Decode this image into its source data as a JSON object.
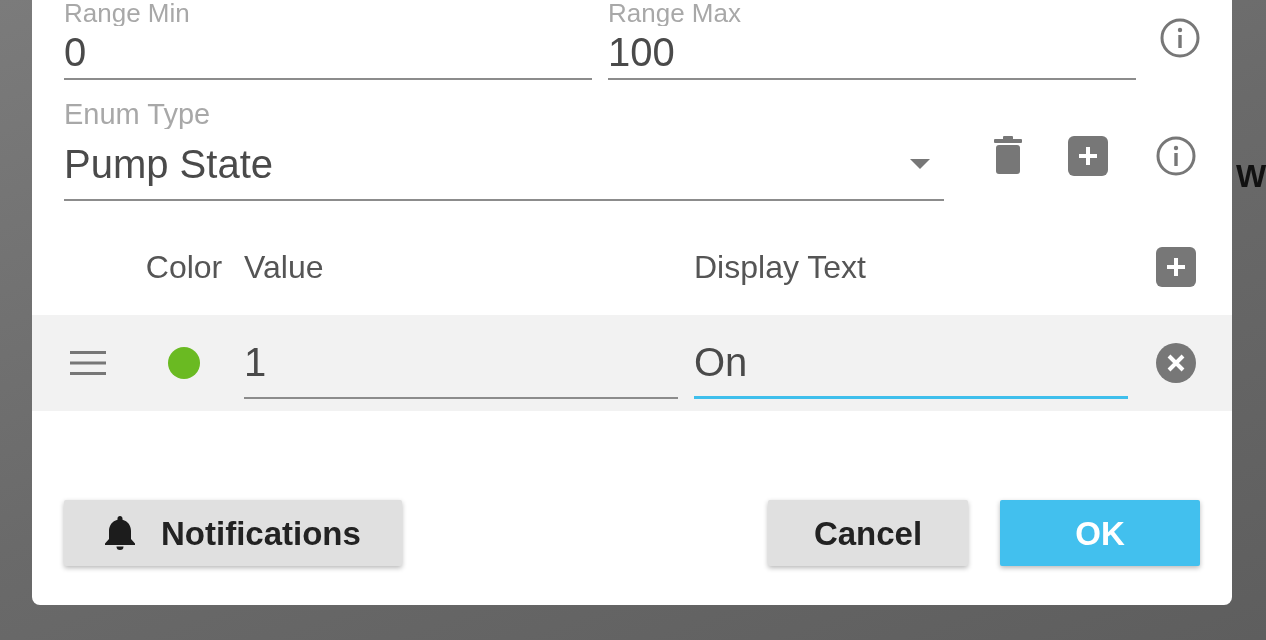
{
  "background_text": "W",
  "dialog": {
    "range": [
      {
        "label": "Range Min",
        "value": "0"
      },
      {
        "label": "Range Max",
        "value": "100"
      }
    ],
    "enum_type": {
      "label": "Enum Type",
      "value": "Pump State"
    },
    "enum_table": {
      "columns": [
        "Color",
        "Value",
        "Display Text"
      ],
      "rows": [
        {
          "color": "#6aba22",
          "value": {
            "text": "1",
            "focused": false
          },
          "display_text": {
            "text": "On",
            "focused": true
          }
        }
      ]
    },
    "footer": {
      "left": [
        {
          "label": "Notifications",
          "kind": "icon"
        }
      ],
      "right": [
        {
          "label": "Cancel",
          "kind": "plain"
        },
        {
          "label": "OK",
          "kind": "primary"
        }
      ]
    }
  }
}
